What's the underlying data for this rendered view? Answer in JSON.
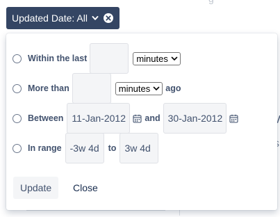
{
  "chip": {
    "label": "Updated Date: All"
  },
  "options": {
    "within": {
      "label": "Within the last",
      "value": "",
      "unit": "minutes"
    },
    "more_than": {
      "label": "More than",
      "value": "",
      "unit": "minutes",
      "suffix": "ago"
    },
    "between": {
      "label": "Between",
      "start": "11-Jan-2012",
      "connector": "and",
      "end": "30-Jan-2012"
    },
    "in_range": {
      "label": "In range",
      "start": "-3w 4d",
      "connector": "to",
      "end": "3w 4d"
    }
  },
  "buttons": {
    "update": "Update",
    "close": "Close"
  }
}
